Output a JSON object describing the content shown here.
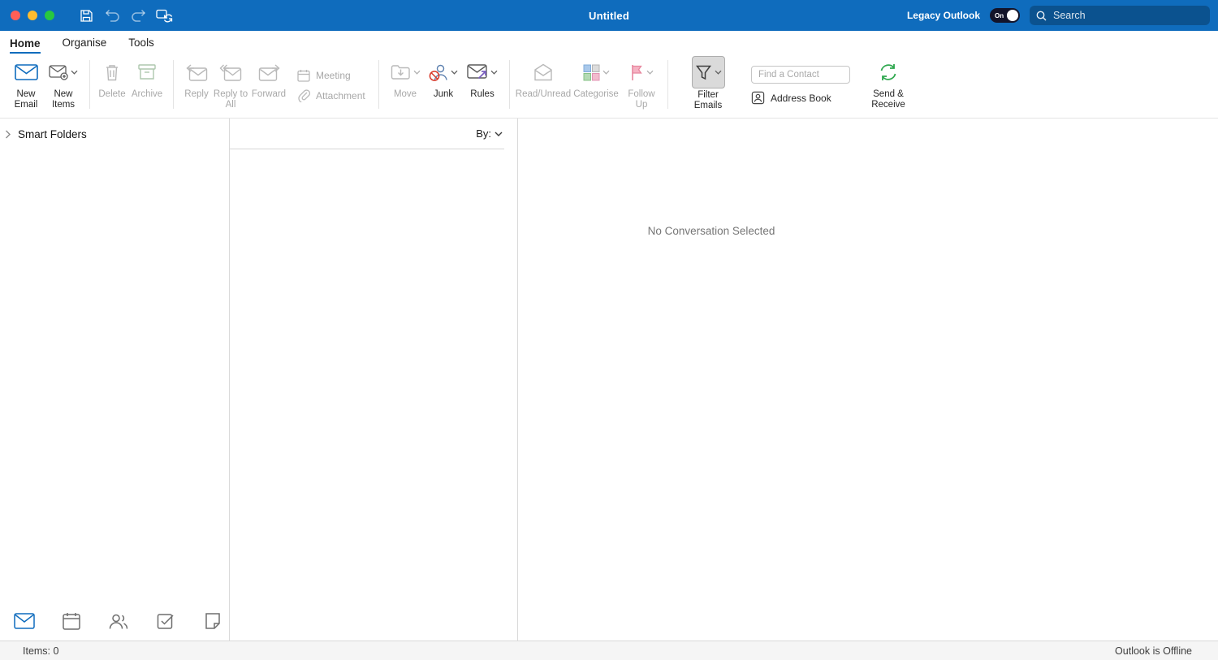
{
  "titlebar": {
    "title": "Untitled",
    "legacy_label": "Legacy Outlook",
    "toggle_state": "On",
    "search_placeholder": "Search"
  },
  "tabs": [
    {
      "label": "Home"
    },
    {
      "label": "Organise"
    },
    {
      "label": "Tools"
    }
  ],
  "ribbon": {
    "new_email": "New Email",
    "new_items": "New Items",
    "delete": "Delete",
    "archive": "Archive",
    "reply": "Reply",
    "reply_to_all": "Reply to All",
    "forward": "Forward",
    "meeting": "Meeting",
    "attachment": "Attachment",
    "move": "Move",
    "junk": "Junk",
    "rules": "Rules",
    "read_unread": "Read/Unread",
    "categorise": "Categorise",
    "follow_up": "Follow Up",
    "filter_emails": "Filter Emails",
    "find_contact_placeholder": "Find a Contact",
    "address_book": "Address Book",
    "send_receive": "Send & Receive"
  },
  "sidebar": {
    "smart_folders": "Smart Folders",
    "nav_icons": [
      "mail-icon",
      "calendar-icon",
      "people-icon",
      "tasks-icon",
      "notes-icon"
    ]
  },
  "message_list": {
    "sort_by_label": "By:"
  },
  "reading_pane": {
    "empty_text": "No Conversation Selected"
  },
  "statusbar": {
    "items_count": "Items: 0",
    "connection_status": "Outlook is Offline"
  },
  "colors": {
    "titlebar_blue": "#0f6cbd",
    "accent_blue": "#0f6cbd",
    "junk_red": "#d93a2b",
    "rules_purple": "#7a5fbe",
    "flag_pink": "#e8879e",
    "archive_green": "#aec7ae",
    "send_receive_green": "#2fa84f"
  }
}
